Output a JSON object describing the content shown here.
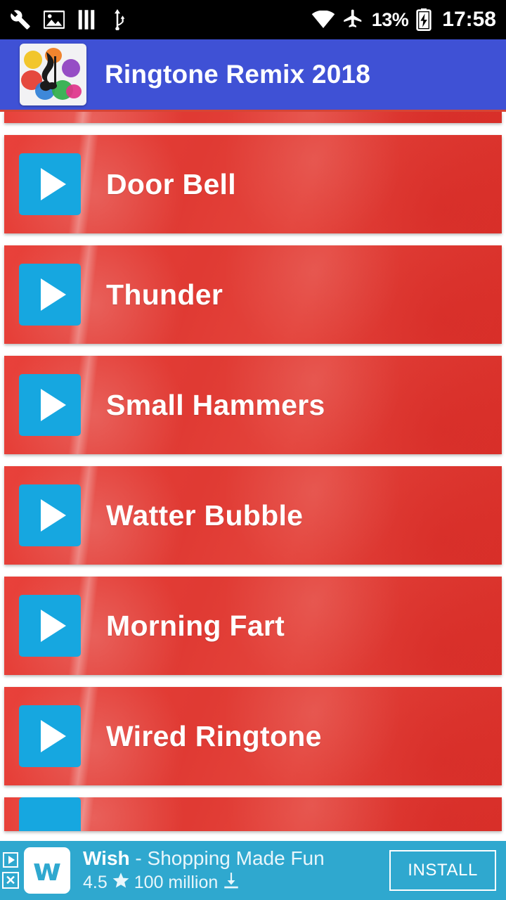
{
  "status_bar": {
    "icons_left": [
      "wrench-icon",
      "image-icon",
      "sim-card-icon",
      "usb-icon"
    ],
    "wifi_icon": "wifi-icon",
    "airplane_icon": "airplane-mode-icon",
    "battery_percent": "13%",
    "battery_icon": "battery-charging-icon",
    "clock": "17:58"
  },
  "app_bar": {
    "logo_icon": "app-logo-music-note-icon",
    "title": "Ringtone Remix 2018",
    "background_color": "#3f51d5",
    "accent_underline_color": "#d64535"
  },
  "list": {
    "row_color": "#e0392f",
    "play_button_color": "#16a7e0",
    "items": [
      {
        "label": "Door Bell",
        "play_icon": "play-icon"
      },
      {
        "label": "Thunder",
        "play_icon": "play-icon"
      },
      {
        "label": "Small Hammers",
        "play_icon": "play-icon"
      },
      {
        "label": "Watter Bubble",
        "play_icon": "play-icon"
      },
      {
        "label": "Morning Fart",
        "play_icon": "play-icon"
      },
      {
        "label": "Wired Ringtone",
        "play_icon": "play-icon"
      }
    ]
  },
  "ad": {
    "badge_icon": "ad-choices-icon",
    "close_icon": "close-icon",
    "app_icon": "wish-app-icon",
    "app_icon_letter": "w",
    "title": "Wish",
    "tagline": "- Shopping Made Fun",
    "rating": "4.5",
    "star_icon": "star-icon",
    "downloads": "100 million",
    "download_icon": "download-icon",
    "install_label": "INSTALL",
    "background_color": "#2fa8cf"
  }
}
